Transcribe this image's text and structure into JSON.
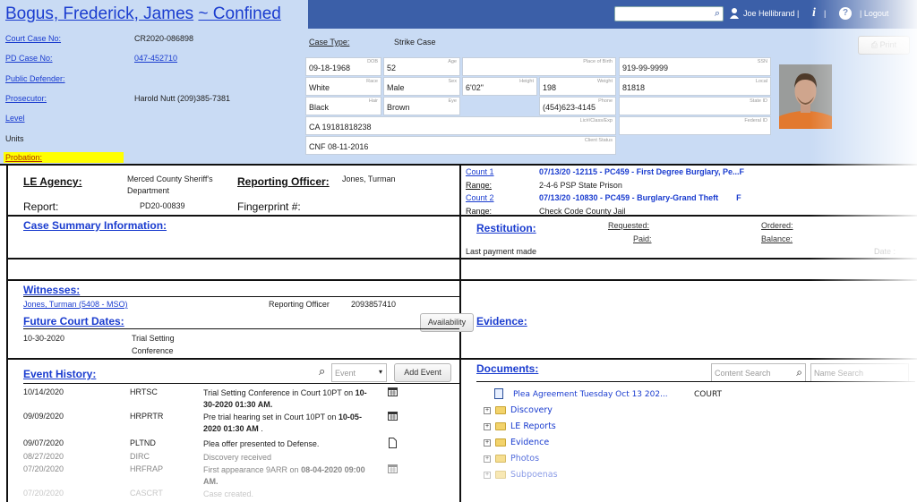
{
  "header": {
    "name": "Bogus, Frederick, James",
    "status": "~ Confined",
    "search_placeholder": "",
    "user": "Joe Hellibrand |",
    "logout": "| Logout",
    "print": "Print"
  },
  "case": {
    "court_case_label": "Court Case No:",
    "court_case_value": "CR2020-086898",
    "pd_case_label": "PD Case No:",
    "pd_case_value": "047-452710",
    "public_defender_label": "Public Defender:",
    "prosecutor_label": "Prosecutor:",
    "prosecutor_value": "Harold Nutt (209)385-7381",
    "level_label": "Level",
    "units_label": "Units",
    "probation_label": "Probation:",
    "case_type_label": "Case Type:",
    "case_type_value": "Strike Case"
  },
  "demographics": {
    "dob": {
      "label": "DOB",
      "value": "09-18-1968"
    },
    "age": {
      "label": "Age",
      "value": "52"
    },
    "place_of_birth": {
      "label": "Place of Birth",
      "value": ""
    },
    "ssn": {
      "label": "SSN",
      "value": "919-99-9999"
    },
    "race": {
      "label": "Race",
      "value": "White"
    },
    "sex": {
      "label": "Sex",
      "value": "Male"
    },
    "height": {
      "label": "Height",
      "value": "6'02\""
    },
    "weight": {
      "label": "Weight",
      "value": "198"
    },
    "local": {
      "label": "Local",
      "value": "81818"
    },
    "hair": {
      "label": "Hair",
      "value": "Black"
    },
    "eye": {
      "label": "Eye",
      "value": "Brown"
    },
    "phone": {
      "label": "Phone",
      "value": "(454)623-4145"
    },
    "state_id": {
      "label": "State ID",
      "value": ""
    },
    "license": {
      "label": "Lic#/Class/Exp",
      "value": "CA 19181818238"
    },
    "federal_id": {
      "label": "Federal ID",
      "value": ""
    },
    "client_status": {
      "label": "Client Status",
      "value": "CNF 08-11-2016"
    }
  },
  "le": {
    "agency_label": "LE Agency:",
    "agency_value": "Merced County Sheriff's Department",
    "officer_label": "Reporting Officer:",
    "officer_value": "Jones, Turman",
    "report_label": "Report:",
    "report_value": "PD20-00839",
    "fingerprint_label": "Fingerprint #:"
  },
  "counts": [
    {
      "label": "Count 1",
      "value": "07/13/20 -12115 - PC459 - First Degree Burglary, Pe...F",
      "range_label": "Range:",
      "range_value": "2-4-6 PSP State Prison"
    },
    {
      "label": "Count 2",
      "value": "07/13/20 -10830 - PC459 - Burglary-Grand Theft        F",
      "range_label": "Range:",
      "range_value": "Check Code County Jail"
    }
  ],
  "case_summary_title": "Case Summary Information:",
  "restitution": {
    "title": "Restitution:",
    "requested": "Requested:",
    "paid": "Paid:",
    "ordered": "Ordered:",
    "balance": "Balance:",
    "last_payment": "Last payment made",
    "date": "Date :"
  },
  "witnesses": {
    "title": "Witnesses:",
    "name": "Jones, Turman (5408 - MSO)",
    "role": "Reporting Officer",
    "phone": "2093857410"
  },
  "future_court": {
    "title": "Future Court Dates:",
    "availability": "Availability",
    "date": "10-30-2020",
    "event_line1": "Trial Setting",
    "event_line2": "Conference"
  },
  "evidence_title": "Evidence:",
  "event_history": {
    "title": "Event History:",
    "filter_placeholder": "Event",
    "add_event": "Add Event",
    "rows": [
      {
        "date": "10/14/2020",
        "code": "HRTSC",
        "text1": "Trial Setting Conference in Court 10PT on ",
        "bold1": "10-",
        "bold2": "30-2020 01:30 AM.",
        "icon": "calendar-icon"
      },
      {
        "date": "09/09/2020",
        "code": "HRPRTR",
        "text1": "Pre trial hearing set in Court 10PT on ",
        "bold1": "10-05-",
        "bold2": "2020 01:30 AM",
        "tail": " .",
        "icon": "calendar-icon"
      },
      {
        "date": "09/07/2020",
        "code": "PLTND",
        "text1": "Plea offer presented to Defense.",
        "icon": "document-icon"
      },
      {
        "date": "08/27/2020",
        "code": "DIRC",
        "text1": "Discovery received"
      },
      {
        "date": "07/20/2020",
        "code": "HRFRAP",
        "text1": "First appearance 9ARR on ",
        "bold1": "08-04-2020 09:00",
        "bold2": "AM.",
        "icon": "calendar-icon"
      },
      {
        "date": "07/20/2020",
        "code": "CASCRT",
        "text1": "Case created."
      }
    ]
  },
  "documents": {
    "title": "Documents:",
    "content_search": "Content Search",
    "name_search": "Name Search",
    "file": {
      "name": "Plea Agreement Tuesday Oct 13 202...",
      "location": "COURT"
    },
    "folders": [
      "Discovery",
      "LE Reports",
      "Evidence",
      "Photos",
      "Subpoenas"
    ]
  },
  "colors": {
    "link": "#1a3ccf",
    "header_bg": "#c9dbf4",
    "topbar": "#3b5fa8",
    "probation_highlight": "#ffff00"
  }
}
